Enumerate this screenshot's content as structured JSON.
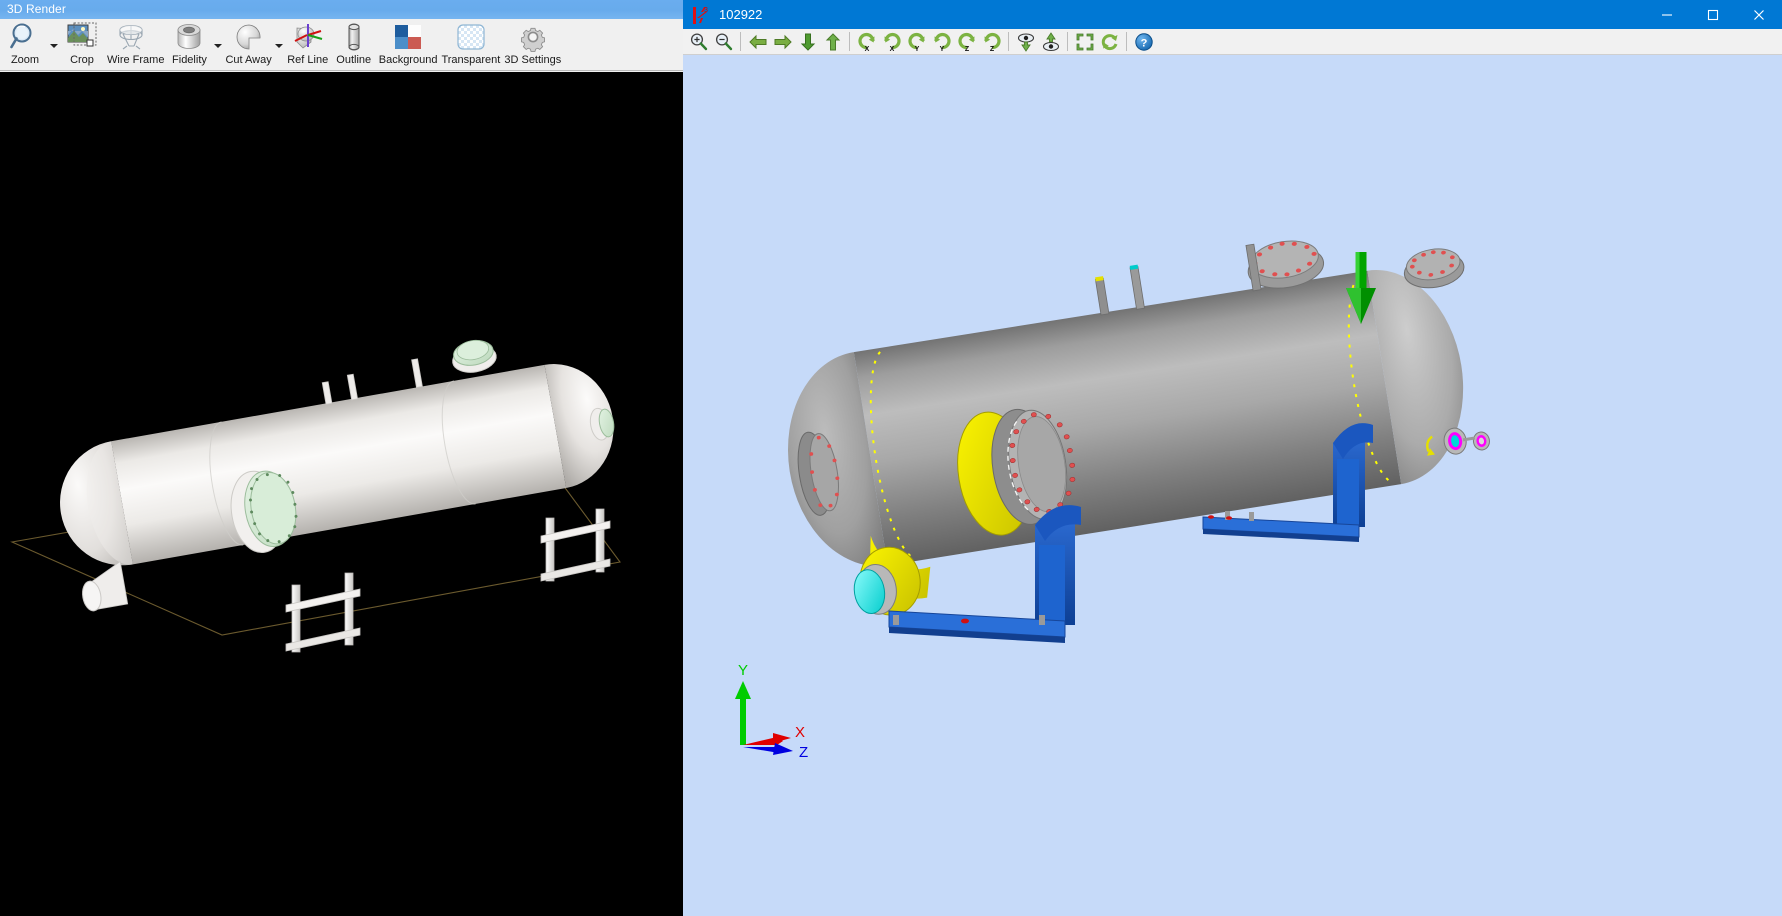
{
  "left_window": {
    "title": "3D Render",
    "titlebar_color": "#6aadef",
    "canvas_background": "#000000",
    "toolbar": [
      {
        "label": "Zoom",
        "icon": "magnifier-icon",
        "has_dropdown": true
      },
      {
        "label": "Crop",
        "icon": "crop-image-icon",
        "has_dropdown": false
      },
      {
        "label": "Wire Frame",
        "icon": "wireframe-icon",
        "has_dropdown": false
      },
      {
        "label": "Fidelity",
        "icon": "cylinder-fidelity-icon",
        "has_dropdown": true
      },
      {
        "label": "Cut Away",
        "icon": "cut-away-sphere-icon",
        "has_dropdown": true
      },
      {
        "label": "Ref Line",
        "icon": "reference-axis-icon",
        "has_dropdown": false
      },
      {
        "label": "Outline",
        "icon": "outline-cylinder-icon",
        "has_dropdown": false
      },
      {
        "label": "Background",
        "icon": "background-swatch-icon",
        "has_dropdown": false
      },
      {
        "label": "Transparent",
        "icon": "transparency-grid-icon",
        "has_dropdown": false
      },
      {
        "label": "3D Settings",
        "icon": "gear-icon",
        "has_dropdown": false
      }
    ],
    "model": {
      "name": "horizontal-pressure-vessel",
      "shell_color": "#efedea",
      "flange_color": "#cfe6cf",
      "support_color": "#e8e6e3",
      "ground_grid_color": "#6b5a2e",
      "nozzles": 5,
      "saddle_supports": 2
    }
  },
  "right_window": {
    "title": "102922",
    "titlebar_color": "#0078d4",
    "canvas_background": "#c6daf9",
    "logo": "f3-red-flag-icon",
    "window_controls": [
      {
        "name": "minimize-button",
        "glyph": "minimize-icon"
      },
      {
        "name": "maximize-button",
        "glyph": "maximize-icon"
      },
      {
        "name": "close-button",
        "glyph": "close-icon"
      }
    ],
    "toolbar": [
      {
        "name": "zoom-in-button",
        "icon": "zoom-in-icon",
        "group": 1
      },
      {
        "name": "zoom-out-button",
        "icon": "zoom-out-icon",
        "group": 1
      },
      {
        "name": "pan-left-button",
        "icon": "arrow-left-icon",
        "group": 2
      },
      {
        "name": "pan-right-button",
        "icon": "arrow-right-icon",
        "group": 2
      },
      {
        "name": "pan-down-button",
        "icon": "arrow-down-icon",
        "group": 2
      },
      {
        "name": "pan-up-button",
        "icon": "arrow-up-icon",
        "group": 2
      },
      {
        "name": "rotate-x-ccw-button",
        "icon": "rotate-ccw-x-icon",
        "group": 3,
        "axis": "X"
      },
      {
        "name": "rotate-x-cw-button",
        "icon": "rotate-cw-x-icon",
        "group": 3,
        "axis": "X"
      },
      {
        "name": "rotate-y-ccw-button",
        "icon": "rotate-ccw-y-icon",
        "group": 3,
        "axis": "Y"
      },
      {
        "name": "rotate-y-cw-button",
        "icon": "rotate-cw-y-icon",
        "group": 3,
        "axis": "Y"
      },
      {
        "name": "rotate-z-ccw-button",
        "icon": "rotate-ccw-z-icon",
        "group": 3,
        "axis": "Z"
      },
      {
        "name": "rotate-z-cw-button",
        "icon": "rotate-cw-z-icon",
        "group": 3,
        "axis": "Z"
      },
      {
        "name": "view-down-button",
        "icon": "eye-down-icon",
        "group": 4
      },
      {
        "name": "view-up-button",
        "icon": "eye-up-icon",
        "group": 4
      },
      {
        "name": "zoom-fit-button",
        "icon": "zoom-fit-icon",
        "group": 5
      },
      {
        "name": "reset-view-button",
        "icon": "refresh-icon",
        "group": 5
      },
      {
        "name": "help-button",
        "icon": "help-question-icon",
        "group": 6
      }
    ],
    "axis_triad": {
      "x": {
        "label": "X",
        "color": "#e00000"
      },
      "y": {
        "label": "Y",
        "color": "#00cc00"
      },
      "z": {
        "label": "Z",
        "color": "#0000e0"
      }
    },
    "model": {
      "name": "horizontal-pressure-vessel",
      "shell_color": "#9a9a9a",
      "nozzle_pad_color": "#e5e000",
      "bolt_color": "#e05050",
      "saddle_color": "#1550b8",
      "inner_bore_color": "#00e0e0",
      "seam_line_color": "#ffff00",
      "small_nozzle_color": "#ff00ff",
      "annotation_arrow": {
        "name": "selection-arrow",
        "color": "#00a000",
        "direction": "down"
      },
      "saddle_supports": 2
    }
  }
}
